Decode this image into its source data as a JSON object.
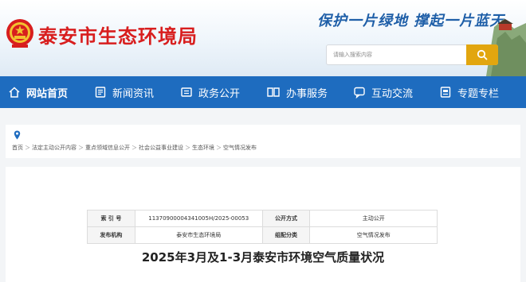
{
  "header": {
    "site_title": "泰安市生态环境局",
    "slogan": "保护一片绿地  撑起一片蓝天",
    "search": {
      "placeholder": "请输入搜索内容",
      "button_icon": "search-icon"
    }
  },
  "nav": {
    "items": [
      {
        "label": "网站首页",
        "icon": "home-icon",
        "active": true
      },
      {
        "label": "新闻资讯",
        "icon": "news-icon"
      },
      {
        "label": "政务公开",
        "icon": "gov-icon"
      },
      {
        "label": "办事服务",
        "icon": "service-icon"
      },
      {
        "label": "互动交流",
        "icon": "chat-icon"
      },
      {
        "label": "专题专栏",
        "icon": "topic-icon"
      }
    ]
  },
  "breadcrumb": {
    "icon": "location-pin-icon",
    "items": [
      "首页",
      "法定主动公开内容",
      "重点领域信息公开",
      "社会公益事业建设",
      "生态环境",
      "空气情况发布"
    ],
    "separator": "＞"
  },
  "meta": {
    "index_label": "索 引 号",
    "index_value": "11370900004341005H/2025-00053",
    "method_label": "公开方式",
    "method_value": "主动公开",
    "publisher_label": "发布机构",
    "publisher_value": "泰安市生态环境局",
    "category_label": "组配分类",
    "category_value": "空气情况发布"
  },
  "article": {
    "title": "2025年3月及1-3月泰安市环境空气质量状况"
  },
  "colors": {
    "nav_bg": "#1e6cbf",
    "title_red": "#d81e1e",
    "search_btn": "#e2a60f",
    "slogan_blue": "#1f5fa8"
  }
}
